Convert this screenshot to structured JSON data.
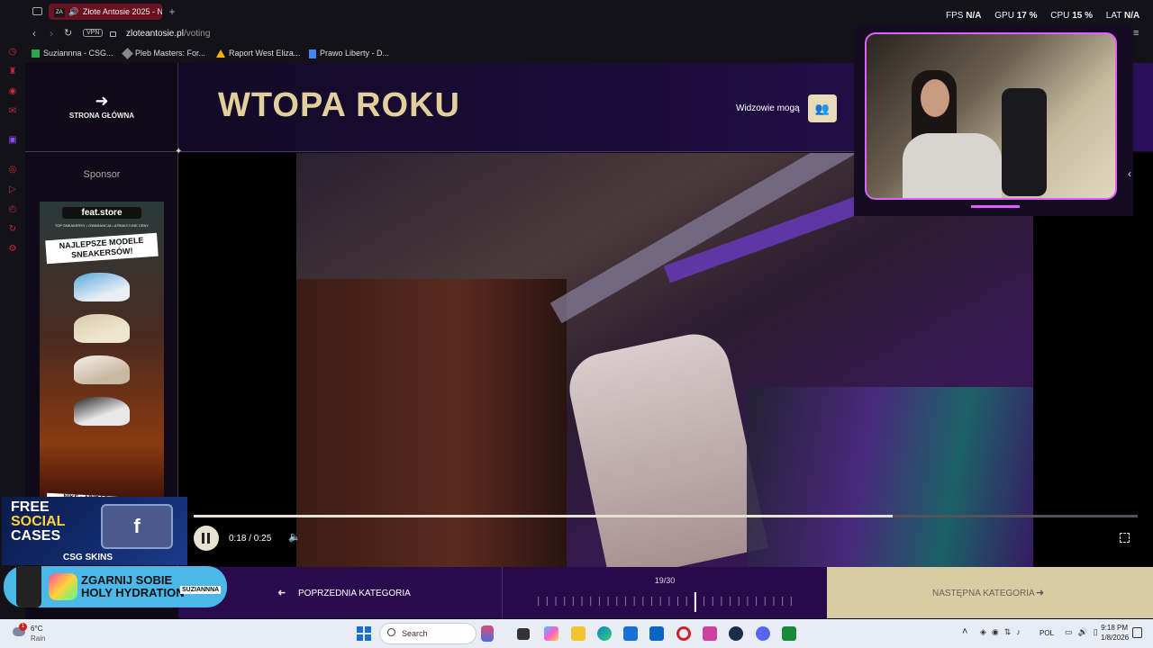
{
  "browser": {
    "tab_title": "Złote Antosie 2025 - N",
    "tab_favicon": "ZA",
    "new_tab": "+",
    "vpn_badge": "VPN",
    "url_domain": "zloteantosie.pl",
    "url_path": "/voting",
    "bookmarks": [
      {
        "label": "Suziannna - CSG...",
        "color": "#2ea44f"
      },
      {
        "label": "Pleb Masters: For...",
        "color": "#888888"
      },
      {
        "label": "Raport West Eliza...",
        "color": "#f4b400"
      },
      {
        "label": "Prawo Liberty - D...",
        "color": "#4285f4"
      }
    ]
  },
  "overlay_stats": {
    "fps_label": "FPS",
    "fps_value": "N/A",
    "gpu_label": "GPU",
    "gpu_value": "17 %",
    "cpu_label": "CPU",
    "cpu_value": "15 %",
    "lat_label": "LAT",
    "lat_value": "N/A"
  },
  "page": {
    "home_label": "STRONA GŁÓWNA",
    "title": "WTOPA ROKU",
    "viewers_label": "Widzowie mogą",
    "sponsor_label": "Sponsor",
    "title_color": "#e3cf9e"
  },
  "ad": {
    "brand": "feat.store",
    "tagline": "TOP SNEAKERSY • GWARANCJA • ATRAKCYJNE CENY",
    "headline_1": "NAJLEPSZE MODELE",
    "headline_2": "SNEAKERSÓW!",
    "footer": "NIKE • ADIDAS • JORDAN"
  },
  "player": {
    "time": "0:18 / 0:25",
    "progress": 0.74
  },
  "navigation": {
    "prev_label": "POPRZEDNIA KATEGORIA",
    "next_label": "NASTĘPNA KATEGORIA",
    "counter": "19/30",
    "current": 19,
    "total": 30
  },
  "promo": {
    "free_1": "FREE",
    "free_2": "SOCIAL",
    "free_3": "CASES",
    "csgo": "CSG SKINS",
    "banner_1": "ZGARNIJ SOBIE",
    "banner_2": "HOLY HYDRATION",
    "banner_tag": "SUZIANNNA"
  },
  "taskbar": {
    "weather_temp": "6°C",
    "weather_desc": "Rain",
    "weather_badge": "1",
    "search_label": "Search",
    "language": "POL",
    "time": "9:18 PM",
    "date": "1/8/2026"
  }
}
